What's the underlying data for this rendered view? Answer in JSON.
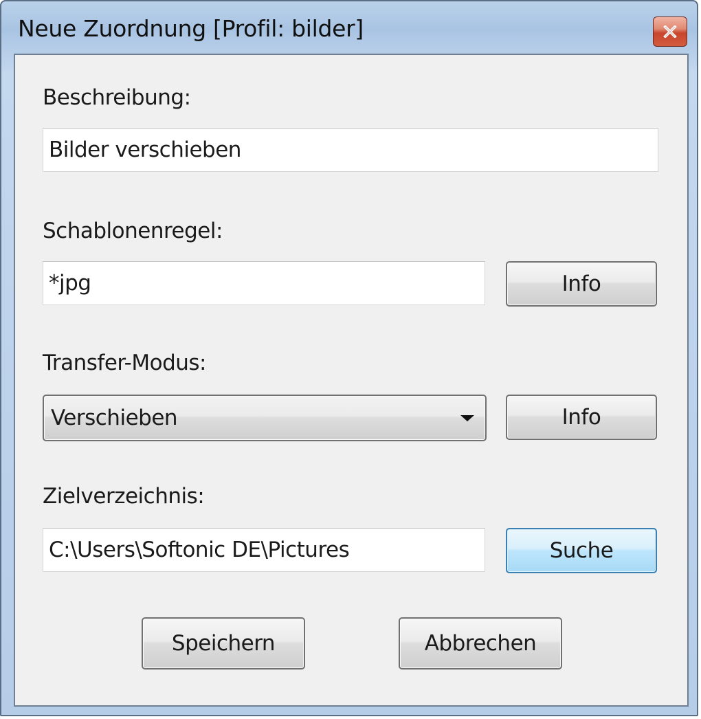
{
  "window": {
    "title": "Neue Zuordnung [Profil: bilder]",
    "close_icon": "close-icon"
  },
  "form": {
    "description_label": "Beschreibung:",
    "description_value": "Bilder verschieben",
    "template_label": "Schablonenregel:",
    "template_value": "*jpg",
    "template_info_label": "Info",
    "transfer_label": "Transfer-Modus:",
    "transfer_selected": "Verschieben",
    "transfer_info_label": "Info",
    "target_label": "Zielverzeichnis:",
    "target_value": "C:\\Users\\Softonic DE\\Pictures",
    "browse_label": "Suche"
  },
  "footer": {
    "save_label": "Speichern",
    "cancel_label": "Abbrechen"
  }
}
